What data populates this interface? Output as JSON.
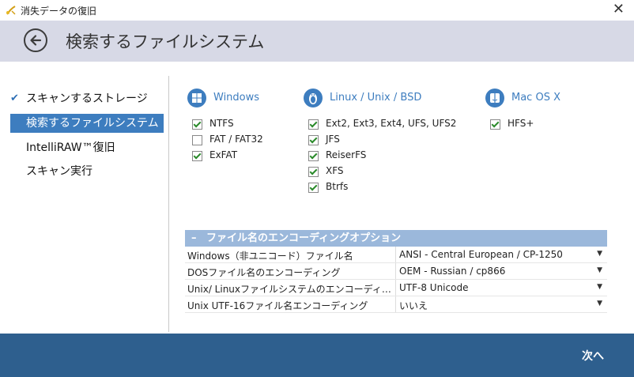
{
  "window": {
    "title": "消失データの復旧",
    "close_label": "✕"
  },
  "header": {
    "title": "検索するファイルシステム"
  },
  "nav": {
    "items": [
      {
        "label": "スキャンするストレージ",
        "checked": true
      },
      {
        "label": "検索するファイルシステム",
        "active": true
      },
      {
        "label": "IntelliRAW™復旧"
      },
      {
        "label": "スキャン実行"
      }
    ],
    "check_glyph": "✔"
  },
  "filesystems": {
    "windows": {
      "label": "Windows",
      "items": [
        {
          "name": "NTFS",
          "checked": true
        },
        {
          "name": "FAT / FAT32",
          "checked": false
        },
        {
          "name": "ExFAT",
          "checked": true
        }
      ]
    },
    "linux": {
      "label": "Linux / Unix / BSD",
      "items": [
        {
          "name": "Ext2, Ext3, Ext4, UFS, UFS2",
          "checked": true
        },
        {
          "name": "JFS",
          "checked": true
        },
        {
          "name": "ReiserFS",
          "checked": true
        },
        {
          "name": "XFS",
          "checked": true
        },
        {
          "name": "Btrfs",
          "checked": true
        }
      ]
    },
    "mac": {
      "label": "Mac OS X",
      "items": [
        {
          "name": "HFS+",
          "checked": true
        }
      ]
    }
  },
  "encoding": {
    "title": "ファイル名のエンコーディングオプション",
    "collapse_glyph": "–",
    "rows": [
      {
        "key": "Windows（非ユニコード）ファイル名",
        "value": "ANSI - Central European / CP-1250"
      },
      {
        "key": "DOSファイル名のエンコーディング",
        "value": "OEM - Russian / cp866"
      },
      {
        "key": "Unix/ Linuxファイルシステムのエンコーディ…",
        "value": "UTF-8 Unicode"
      },
      {
        "key": "Unix UTF-16ファイル名エンコーディング",
        "value": "いいえ"
      }
    ],
    "dropdown_glyph": "▼"
  },
  "footer": {
    "next_label": "次へ"
  },
  "colors": {
    "accent": "#3d7dbf",
    "header_bg": "#d7d9e6",
    "footer_bg": "#2e5f8e",
    "check_green": "#2a8a2a"
  }
}
